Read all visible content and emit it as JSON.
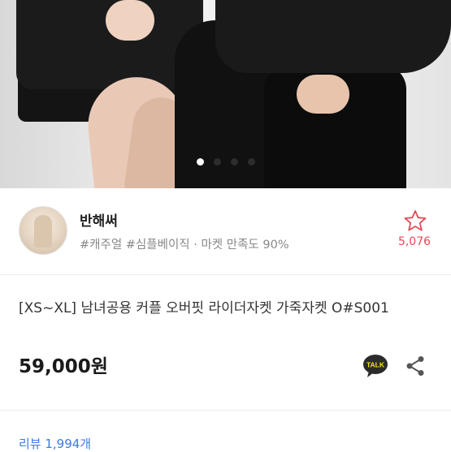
{
  "gallery": {
    "image": "couple-leather-jacket-photo",
    "dots": 4,
    "active_dot": 1
  },
  "seller": {
    "name": "반해써",
    "tags": "#캐주얼 #심플베이직 · 마켓 만족도 90%",
    "like_count": "5,076"
  },
  "product": {
    "title": "[XS~XL] 남녀공용 커플 오버핏 라이더자켓 가죽자켓 O#S001",
    "price": "59,000원",
    "talk_label": "TALK"
  },
  "review": {
    "label": "리뷰 1,994개"
  },
  "colors": {
    "accent": "#e84855",
    "link": "#3d7be0",
    "talk_bg": "#2b2b2b",
    "talk_text": "#f7e600"
  },
  "icons": {
    "like": "star-outline-icon",
    "talk": "kakao-talk-icon",
    "share": "share-icon"
  }
}
